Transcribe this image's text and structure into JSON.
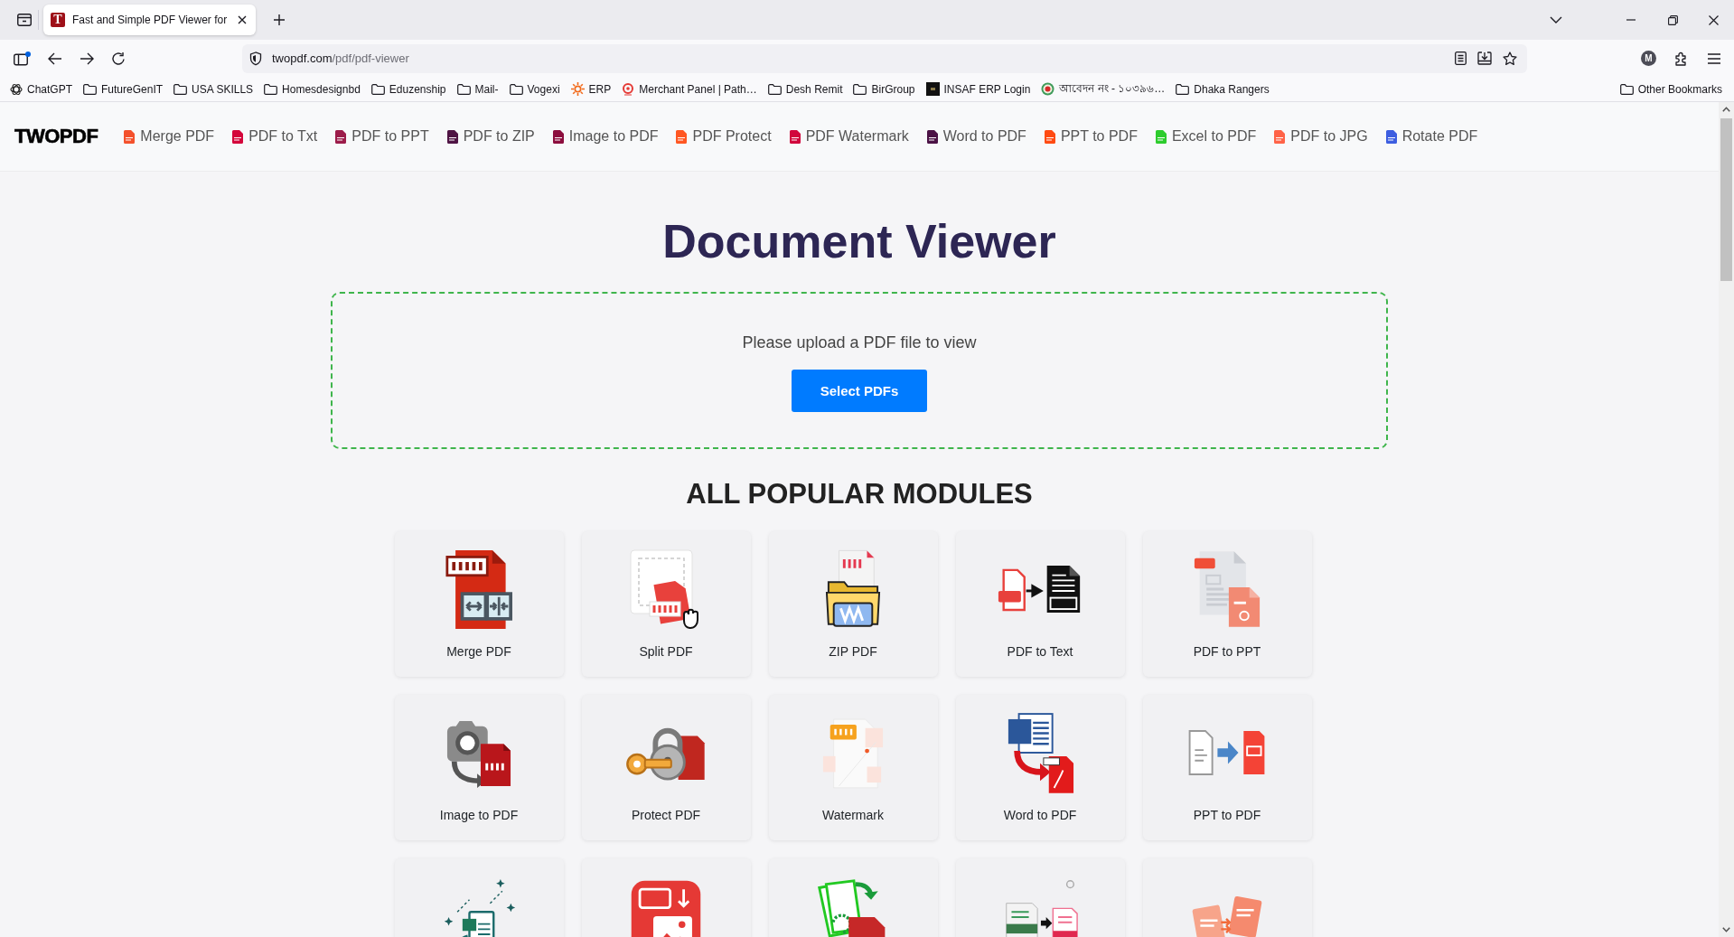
{
  "browser": {
    "tab": {
      "favicon_letter": "T",
      "title": "Fast and Simple PDF Viewer for",
      "selected": true
    },
    "address": {
      "host": "twopdf.com",
      "path": "/pdf/pdf-viewer"
    },
    "account_initial": "M",
    "bookmarks": [
      {
        "kind": "site",
        "label": "ChatGPT"
      },
      {
        "kind": "folder",
        "label": "FutureGenIT"
      },
      {
        "kind": "folder",
        "label": "USA SKILLS"
      },
      {
        "kind": "folder",
        "label": "Homesdesignbd"
      },
      {
        "kind": "folder",
        "label": "Eduzenship"
      },
      {
        "kind": "folder",
        "label": "Mail-"
      },
      {
        "kind": "folder",
        "label": "Vogexi"
      },
      {
        "kind": "site",
        "label": "ERP"
      },
      {
        "kind": "site",
        "label": "Merchant Panel | Path…"
      },
      {
        "kind": "folder",
        "label": "Desh Remit"
      },
      {
        "kind": "folder",
        "label": "BirGroup"
      },
      {
        "kind": "site",
        "label": "INSAF ERP Login"
      },
      {
        "kind": "site",
        "label": "আবেদন নং - ১০৩৯৬…"
      },
      {
        "kind": "folder",
        "label": "Dhaka Rangers"
      }
    ],
    "other_bookmarks": {
      "kind": "folder",
      "label": "Other Bookmarks"
    }
  },
  "site": {
    "logo": "TWOPDF",
    "nav": [
      {
        "label": "Merge PDF",
        "color": "#f4512c"
      },
      {
        "label": "PDF to Txt",
        "color": "#d4063b"
      },
      {
        "label": "PDF to PPT",
        "color": "#9c1c4a"
      },
      {
        "label": "PDF to ZIP",
        "color": "#4f1444"
      },
      {
        "label": "Image to PDF",
        "color": "#8c0e3e"
      },
      {
        "label": "PDF Protect",
        "color": "#ff5722"
      },
      {
        "label": "PDF Watermark",
        "color": "#d1063c"
      },
      {
        "label": "Word to PDF",
        "color": "#4b1245"
      },
      {
        "label": "PPT to PDF",
        "color": "#ff4b12"
      },
      {
        "label": "Excel to PDF",
        "color": "#2dcc2d"
      },
      {
        "label": "PDF to JPG",
        "color": "#ff6347"
      },
      {
        "label": "Rotate PDF",
        "color": "#3d5ee0"
      }
    ],
    "title": "Document Viewer",
    "upload": {
      "prompt": "Please upload a PDF file to view",
      "button": "Select PDFs"
    },
    "modules_heading": "ALL POPULAR MODULES",
    "modules": [
      {
        "kind": "full",
        "label": "Merge PDF"
      },
      {
        "kind": "full",
        "label": "Split PDF"
      },
      {
        "kind": "full",
        "label": "ZIP PDF"
      },
      {
        "kind": "full",
        "label": "PDF to Text"
      },
      {
        "kind": "full",
        "label": "PDF to PPT"
      },
      {
        "kind": "full",
        "label": "Image to PDF"
      },
      {
        "kind": "full",
        "label": "Protect PDF"
      },
      {
        "kind": "full",
        "label": "Watermark"
      },
      {
        "kind": "full",
        "label": "Word to PDF"
      },
      {
        "kind": "full",
        "label": "PPT to PDF"
      },
      {
        "kind": "cut_off"
      },
      {
        "kind": "cut_off"
      },
      {
        "kind": "cut_off"
      },
      {
        "kind": "cut_off"
      },
      {
        "kind": "cut_off"
      }
    ]
  }
}
